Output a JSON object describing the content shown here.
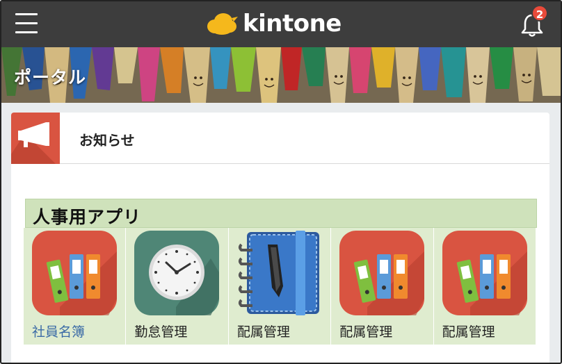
{
  "header": {
    "logo_text": "kintone",
    "notification_count": "2"
  },
  "banner": {
    "title": "ポータル"
  },
  "notice": {
    "title": "お知らせ"
  },
  "section": {
    "title": "人事用アプリ"
  },
  "apps": [
    {
      "label": "社員名簿",
      "icon": "binders-icon",
      "bg": "#d95441"
    },
    {
      "label": "勤怠管理",
      "icon": "clock-icon",
      "bg": "#4f8676"
    },
    {
      "label": "配属管理",
      "icon": "notebook-icon",
      "bg": "none"
    },
    {
      "label": "配属管理",
      "icon": "binders-icon",
      "bg": "#d95441"
    },
    {
      "label": "配属管理",
      "icon": "binders-icon",
      "bg": "#d95441"
    }
  ],
  "colors": {
    "header_bg": "#3d3d3d",
    "accent_red": "#d95441",
    "section_green": "#cfe2bb",
    "app_tile_bg": "#dfeccf",
    "logo_yellow": "#f5b81c"
  }
}
